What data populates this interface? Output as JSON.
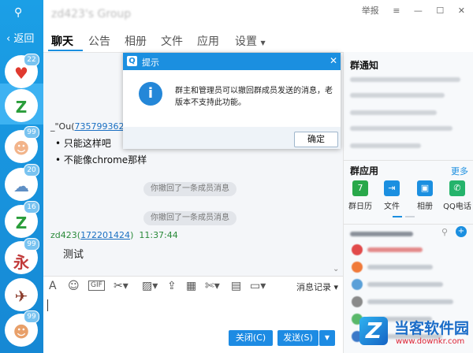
{
  "rail": {
    "back": "返回",
    "avatars": [
      {
        "badge": "22",
        "color": "#e03a2f",
        "glyph": "♥"
      },
      {
        "badge": "",
        "color": "#2a9d3a",
        "glyph": "Z"
      },
      {
        "badge": "99",
        "color": "#f2b48a",
        "glyph": "☻"
      },
      {
        "badge": "20",
        "color": "#5f8fc4",
        "glyph": "☁"
      },
      {
        "badge": "16",
        "color": "#2a9d3a",
        "glyph": "Z"
      },
      {
        "badge": "99",
        "color": "#c23b3b",
        "glyph": "永"
      },
      {
        "badge": "",
        "color": "#8a3a2a",
        "glyph": "✈"
      },
      {
        "badge": "99",
        "color": "#e8a06a",
        "glyph": "☻"
      }
    ]
  },
  "header": {
    "title": "zd423's Group",
    "report": "举报",
    "tabs": [
      "聊天",
      "公告",
      "相册",
      "文件",
      "应用",
      "设置"
    ]
  },
  "chat": {
    "msg1": {
      "name": "_\"Ou",
      "id": "735799362"
    },
    "msg1_lines": [
      "只能这样吧",
      "不能像chrome那样"
    ],
    "recall": "你撤回了一条成员消息",
    "msg2": {
      "name": "zd423",
      "id": "172201424",
      "time": "11:37:44",
      "text": "测试"
    }
  },
  "toolbar": {
    "history": "消息记录"
  },
  "buttons": {
    "close": "关闭(C)",
    "send": "发送(S)"
  },
  "dialog": {
    "title": "提示",
    "message": "群主和管理员可以撤回群成员发送的消息，老版本不支持此功能。",
    "ok": "确定"
  },
  "right": {
    "notice": "群通知",
    "apps_title": "群应用",
    "more": "更多",
    "apps": [
      {
        "label": "群日历",
        "color": "#29a84a",
        "glyph": "7"
      },
      {
        "label": "文件",
        "color": "#1b8fe0",
        "glyph": "⇥"
      },
      {
        "label": "相册",
        "color": "#1b8fe0",
        "glyph": "▣"
      },
      {
        "label": "QQ电话",
        "color": "#24b36b",
        "glyph": "✆"
      }
    ]
  },
  "watermark": {
    "brand": "当客软件园",
    "url": "www.downkr.com"
  }
}
